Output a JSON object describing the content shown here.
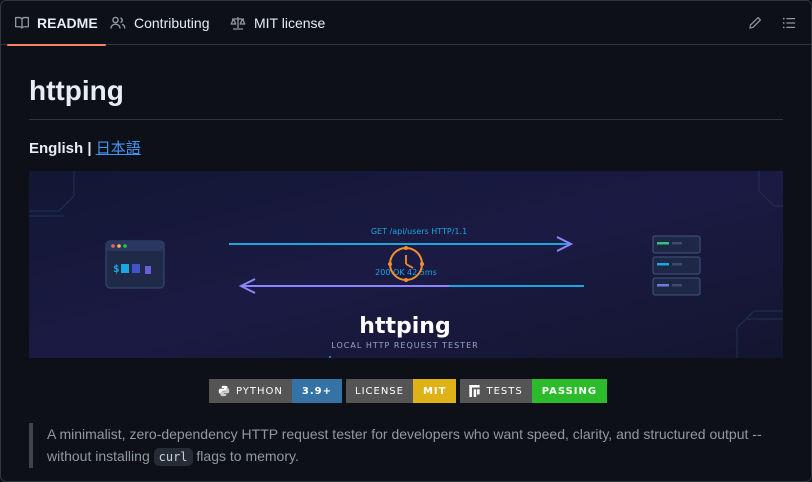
{
  "tabs": [
    {
      "label": "README",
      "icon": "book-icon",
      "active": true
    },
    {
      "label": "Contributing",
      "icon": "people-icon",
      "active": false
    },
    {
      "label": "MIT license",
      "icon": "law-icon",
      "active": false
    }
  ],
  "toolbar": {
    "edit_icon": "pencil-icon",
    "outline_icon": "list-icon"
  },
  "readme": {
    "title": "httping",
    "lang_current": "English",
    "lang_separator": "|",
    "lang_link": "日本語",
    "banner": {
      "request_text": "GET /api/users HTTP/1.1",
      "response_text": "200 OK 42.5ms",
      "title": "httping",
      "subtitle": "LOCAL HTTP REQUEST TESTER",
      "terminal_prompt": "$"
    },
    "badges": [
      {
        "label": "PYTHON",
        "value": "3.9+",
        "value_color": "#3572a5",
        "icon": "python-icon"
      },
      {
        "label": "LICENSE",
        "value": "MIT",
        "value_color": "#dfb317",
        "icon": ""
      },
      {
        "label": "TESTS",
        "value": "PASSING",
        "value_color": "#44cc11",
        "icon": "tests-icon"
      }
    ],
    "quote_part1": "A minimalist, zero-dependency HTTP request tester for developers who want speed, clarity, and structured output -- without installing",
    "quote_code": "curl",
    "quote_part2": "flags to memory."
  },
  "colors": {
    "accent": "#f78166",
    "link": "#4493f8",
    "banner_bg": "#16173a",
    "arrow": "#7b7ff2",
    "cyan": "#1aa7e0"
  }
}
